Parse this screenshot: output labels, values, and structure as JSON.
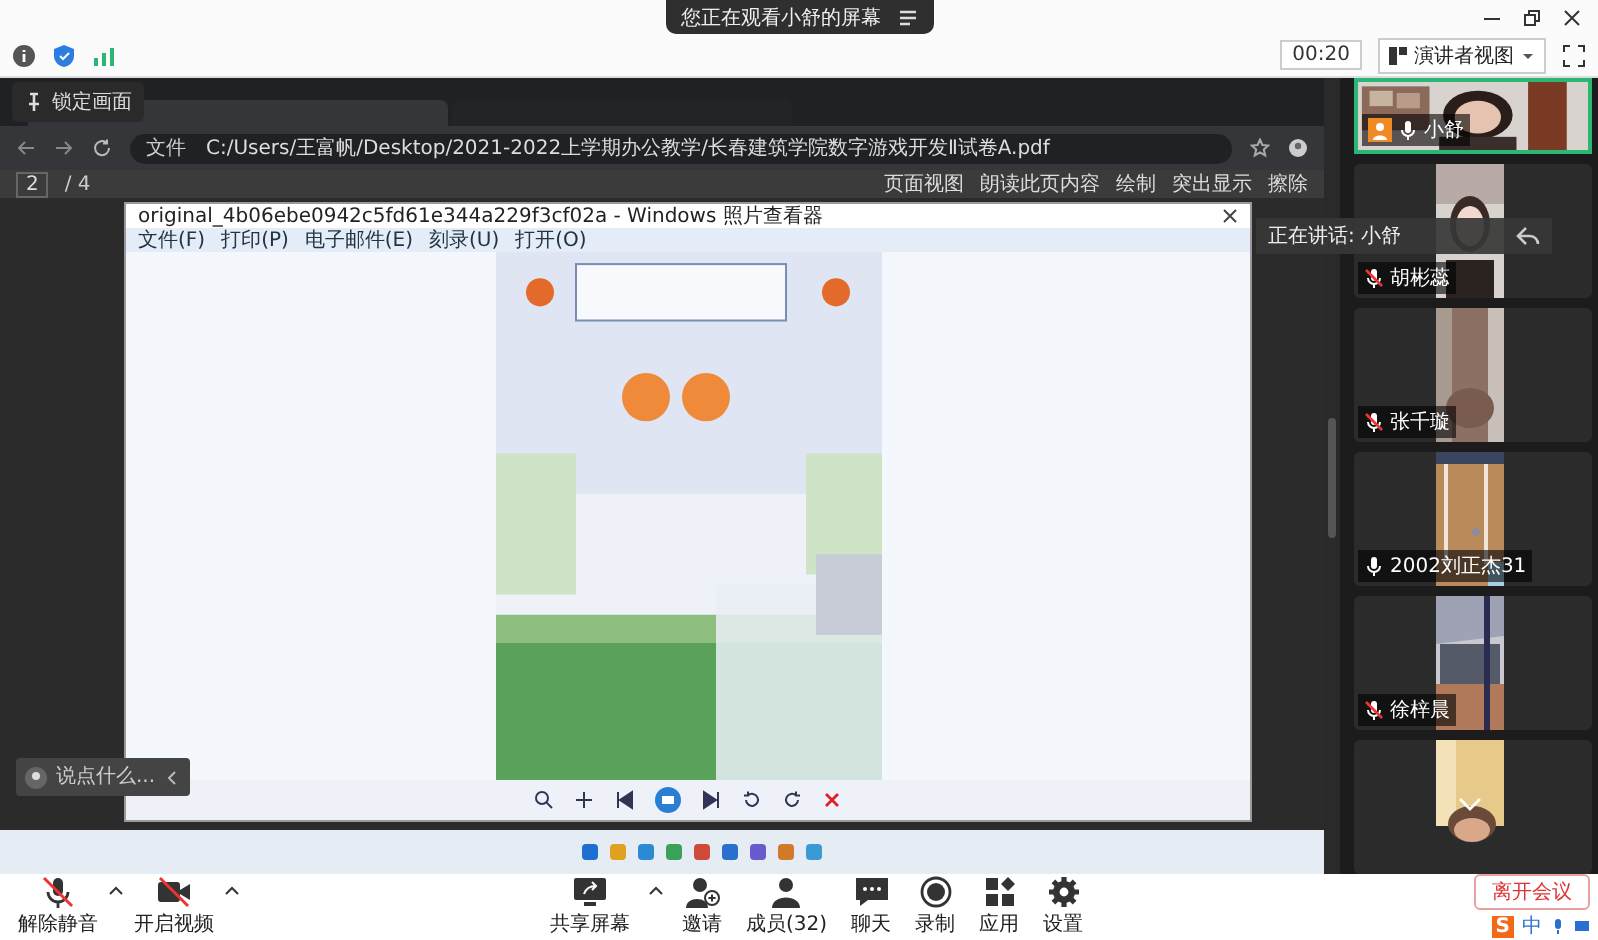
{
  "banner": {
    "text": "您正在观看小舒的屏幕"
  },
  "status": {
    "timer": "00:20",
    "view_mode": "演讲者视图"
  },
  "shared_screen": {
    "lock_label": "锁定画面",
    "browser": {
      "tabs": [
        {
          "selected": true
        },
        {
          "selected": false
        }
      ],
      "address_prefix": "文件",
      "address": "C:/Users/王富帆/Desktop/2021-2022上学期办公教学/长春建筑学院数字游戏开发Ⅱ试卷A.pdf",
      "page": "2",
      "page_count": "/ 4",
      "tools": [
        "页面视图",
        "朗读此页内容",
        "绘制",
        "突出显示",
        "擦除"
      ]
    },
    "viewer": {
      "title": "original_4b06ebe0942c5fd61e344a229f3cf02a - Windows 照片查看器",
      "menus": [
        "文件(F)",
        "打印(P)",
        "电子邮件(E)",
        "刻录(U)",
        "打开(O)"
      ]
    },
    "chat_placeholder": "说点什么..."
  },
  "speaker": {
    "name": "小舒",
    "muted": false,
    "speaking_label": "正在讲话: 小舒"
  },
  "participants": [
    {
      "name": "胡彬蕊",
      "muted": true
    },
    {
      "name": "张千璇",
      "muted": true
    },
    {
      "name": "2002刘正杰31",
      "muted": false
    },
    {
      "name": "徐梓晨",
      "muted": true
    },
    {
      "kind": "picture"
    }
  ],
  "toolbar": {
    "left": [
      {
        "kind": "mic",
        "label": "解除静音",
        "off": true,
        "caret": true
      },
      {
        "kind": "camera",
        "label": "开启视频",
        "off": true,
        "caret": true
      }
    ],
    "center": [
      {
        "kind": "share",
        "label": "共享屏幕",
        "off": false,
        "caret": true
      },
      {
        "kind": "invite",
        "label": "邀请",
        "off": false,
        "caret": false
      },
      {
        "kind": "members",
        "label": "成员(32)",
        "off": false,
        "caret": false
      },
      {
        "kind": "chat",
        "label": "聊天",
        "off": false,
        "caret": false
      },
      {
        "kind": "record",
        "label": "录制",
        "off": false,
        "caret": false
      },
      {
        "kind": "apps",
        "label": "应用",
        "off": false,
        "caret": false
      },
      {
        "kind": "settings",
        "label": "设置",
        "off": false,
        "caret": false
      }
    ],
    "leave_button": "离开会议"
  },
  "ime": {
    "logo": "S",
    "mode": "中"
  }
}
